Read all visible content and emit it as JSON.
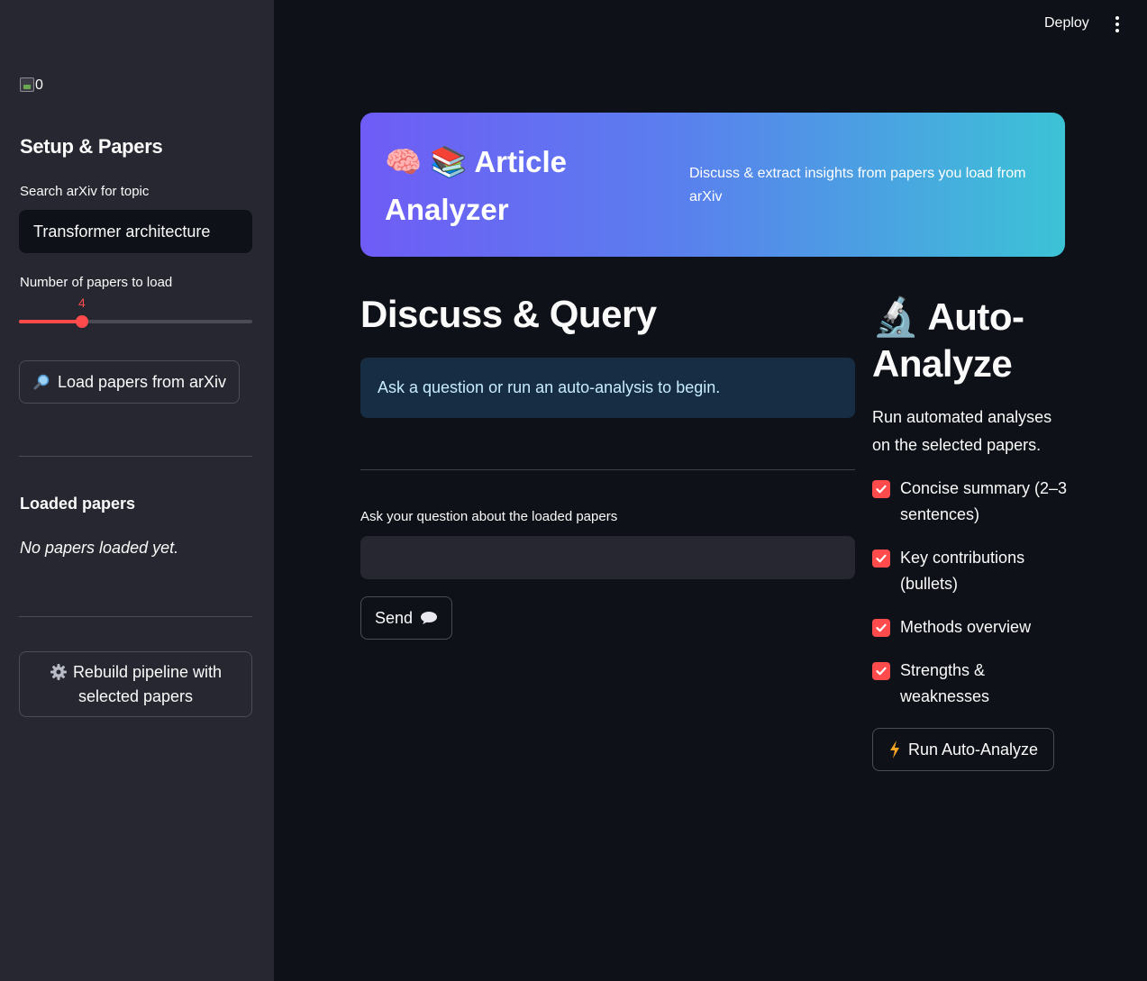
{
  "header": {
    "deploy_label": "Deploy",
    "menu_icon": "kebab-menu-icon"
  },
  "sidebar": {
    "image_alt": "0",
    "title": "Setup & Papers",
    "search_label": "Search arXiv for topic",
    "search_value": "Transformer architecture",
    "slider_label": "Number of papers to load",
    "slider_value": "4",
    "slider_fraction": 0.27,
    "load_button": "Load papers from arXiv",
    "load_icon": "magnifier-icon",
    "loaded_title": "Loaded papers",
    "loaded_empty": "No papers loaded yet.",
    "rebuild_button_line1": "Rebuild pipeline with",
    "rebuild_button_line2": "selected papers",
    "rebuild_icon": "gear-icon"
  },
  "banner": {
    "title_emoji": "🧠 📚",
    "title": "Article Analyzer",
    "subtitle": "Discuss & extract insights from papers you load from arXiv"
  },
  "main": {
    "title": "Discuss & Query",
    "info": "Ask a question or run an auto-analysis to begin.",
    "question_label": "Ask your question about the loaded papers",
    "question_value": "",
    "send_button": "Send",
    "send_icon": "speech-bubble-icon"
  },
  "auto_analyze": {
    "title_emoji": "🔬",
    "title": "Auto-Analyze",
    "description": "Run automated analyses on the selected papers.",
    "options": [
      {
        "label": "Concise summary (2–3 sentences)",
        "checked": true
      },
      {
        "label": "Key contributions (bullets)",
        "checked": true
      },
      {
        "label": "Methods overview",
        "checked": true
      },
      {
        "label": "Strengths & weaknesses",
        "checked": true
      }
    ],
    "run_button": "Run Auto-Analyze",
    "run_icon": "lightning-icon"
  },
  "colors": {
    "accent": "#ff4b4b",
    "sidebar_bg": "#262730",
    "main_bg": "#0e1117",
    "info_bg": "#172d43",
    "banner_start": "#6f5cf6",
    "banner_end": "#3cc3d6"
  }
}
